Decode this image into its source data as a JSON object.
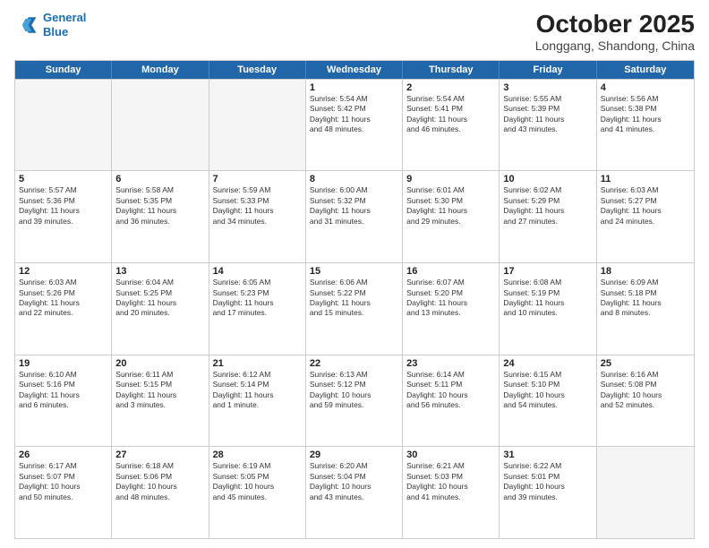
{
  "logo": {
    "line1": "General",
    "line2": "Blue"
  },
  "title": "October 2025",
  "subtitle": "Longgang, Shandong, China",
  "days": [
    "Sunday",
    "Monday",
    "Tuesday",
    "Wednesday",
    "Thursday",
    "Friday",
    "Saturday"
  ],
  "rows": [
    [
      {
        "day": "",
        "info": "",
        "empty": true
      },
      {
        "day": "",
        "info": "",
        "empty": true
      },
      {
        "day": "",
        "info": "",
        "empty": true
      },
      {
        "day": "1",
        "info": "Sunrise: 5:54 AM\nSunset: 5:42 PM\nDaylight: 11 hours\nand 48 minutes."
      },
      {
        "day": "2",
        "info": "Sunrise: 5:54 AM\nSunset: 5:41 PM\nDaylight: 11 hours\nand 46 minutes."
      },
      {
        "day": "3",
        "info": "Sunrise: 5:55 AM\nSunset: 5:39 PM\nDaylight: 11 hours\nand 43 minutes."
      },
      {
        "day": "4",
        "info": "Sunrise: 5:56 AM\nSunset: 5:38 PM\nDaylight: 11 hours\nand 41 minutes."
      }
    ],
    [
      {
        "day": "5",
        "info": "Sunrise: 5:57 AM\nSunset: 5:36 PM\nDaylight: 11 hours\nand 39 minutes."
      },
      {
        "day": "6",
        "info": "Sunrise: 5:58 AM\nSunset: 5:35 PM\nDaylight: 11 hours\nand 36 minutes."
      },
      {
        "day": "7",
        "info": "Sunrise: 5:59 AM\nSunset: 5:33 PM\nDaylight: 11 hours\nand 34 minutes."
      },
      {
        "day": "8",
        "info": "Sunrise: 6:00 AM\nSunset: 5:32 PM\nDaylight: 11 hours\nand 31 minutes."
      },
      {
        "day": "9",
        "info": "Sunrise: 6:01 AM\nSunset: 5:30 PM\nDaylight: 11 hours\nand 29 minutes."
      },
      {
        "day": "10",
        "info": "Sunrise: 6:02 AM\nSunset: 5:29 PM\nDaylight: 11 hours\nand 27 minutes."
      },
      {
        "day": "11",
        "info": "Sunrise: 6:03 AM\nSunset: 5:27 PM\nDaylight: 11 hours\nand 24 minutes."
      }
    ],
    [
      {
        "day": "12",
        "info": "Sunrise: 6:03 AM\nSunset: 5:26 PM\nDaylight: 11 hours\nand 22 minutes."
      },
      {
        "day": "13",
        "info": "Sunrise: 6:04 AM\nSunset: 5:25 PM\nDaylight: 11 hours\nand 20 minutes."
      },
      {
        "day": "14",
        "info": "Sunrise: 6:05 AM\nSunset: 5:23 PM\nDaylight: 11 hours\nand 17 minutes."
      },
      {
        "day": "15",
        "info": "Sunrise: 6:06 AM\nSunset: 5:22 PM\nDaylight: 11 hours\nand 15 minutes."
      },
      {
        "day": "16",
        "info": "Sunrise: 6:07 AM\nSunset: 5:20 PM\nDaylight: 11 hours\nand 13 minutes."
      },
      {
        "day": "17",
        "info": "Sunrise: 6:08 AM\nSunset: 5:19 PM\nDaylight: 11 hours\nand 10 minutes."
      },
      {
        "day": "18",
        "info": "Sunrise: 6:09 AM\nSunset: 5:18 PM\nDaylight: 11 hours\nand 8 minutes."
      }
    ],
    [
      {
        "day": "19",
        "info": "Sunrise: 6:10 AM\nSunset: 5:16 PM\nDaylight: 11 hours\nand 6 minutes."
      },
      {
        "day": "20",
        "info": "Sunrise: 6:11 AM\nSunset: 5:15 PM\nDaylight: 11 hours\nand 3 minutes."
      },
      {
        "day": "21",
        "info": "Sunrise: 6:12 AM\nSunset: 5:14 PM\nDaylight: 11 hours\nand 1 minute."
      },
      {
        "day": "22",
        "info": "Sunrise: 6:13 AM\nSunset: 5:12 PM\nDaylight: 10 hours\nand 59 minutes."
      },
      {
        "day": "23",
        "info": "Sunrise: 6:14 AM\nSunset: 5:11 PM\nDaylight: 10 hours\nand 56 minutes."
      },
      {
        "day": "24",
        "info": "Sunrise: 6:15 AM\nSunset: 5:10 PM\nDaylight: 10 hours\nand 54 minutes."
      },
      {
        "day": "25",
        "info": "Sunrise: 6:16 AM\nSunset: 5:08 PM\nDaylight: 10 hours\nand 52 minutes."
      }
    ],
    [
      {
        "day": "26",
        "info": "Sunrise: 6:17 AM\nSunset: 5:07 PM\nDaylight: 10 hours\nand 50 minutes."
      },
      {
        "day": "27",
        "info": "Sunrise: 6:18 AM\nSunset: 5:06 PM\nDaylight: 10 hours\nand 48 minutes."
      },
      {
        "day": "28",
        "info": "Sunrise: 6:19 AM\nSunset: 5:05 PM\nDaylight: 10 hours\nand 45 minutes."
      },
      {
        "day": "29",
        "info": "Sunrise: 6:20 AM\nSunset: 5:04 PM\nDaylight: 10 hours\nand 43 minutes."
      },
      {
        "day": "30",
        "info": "Sunrise: 6:21 AM\nSunset: 5:03 PM\nDaylight: 10 hours\nand 41 minutes."
      },
      {
        "day": "31",
        "info": "Sunrise: 6:22 AM\nSunset: 5:01 PM\nDaylight: 10 hours\nand 39 minutes."
      },
      {
        "day": "",
        "info": "",
        "empty": true
      }
    ]
  ]
}
